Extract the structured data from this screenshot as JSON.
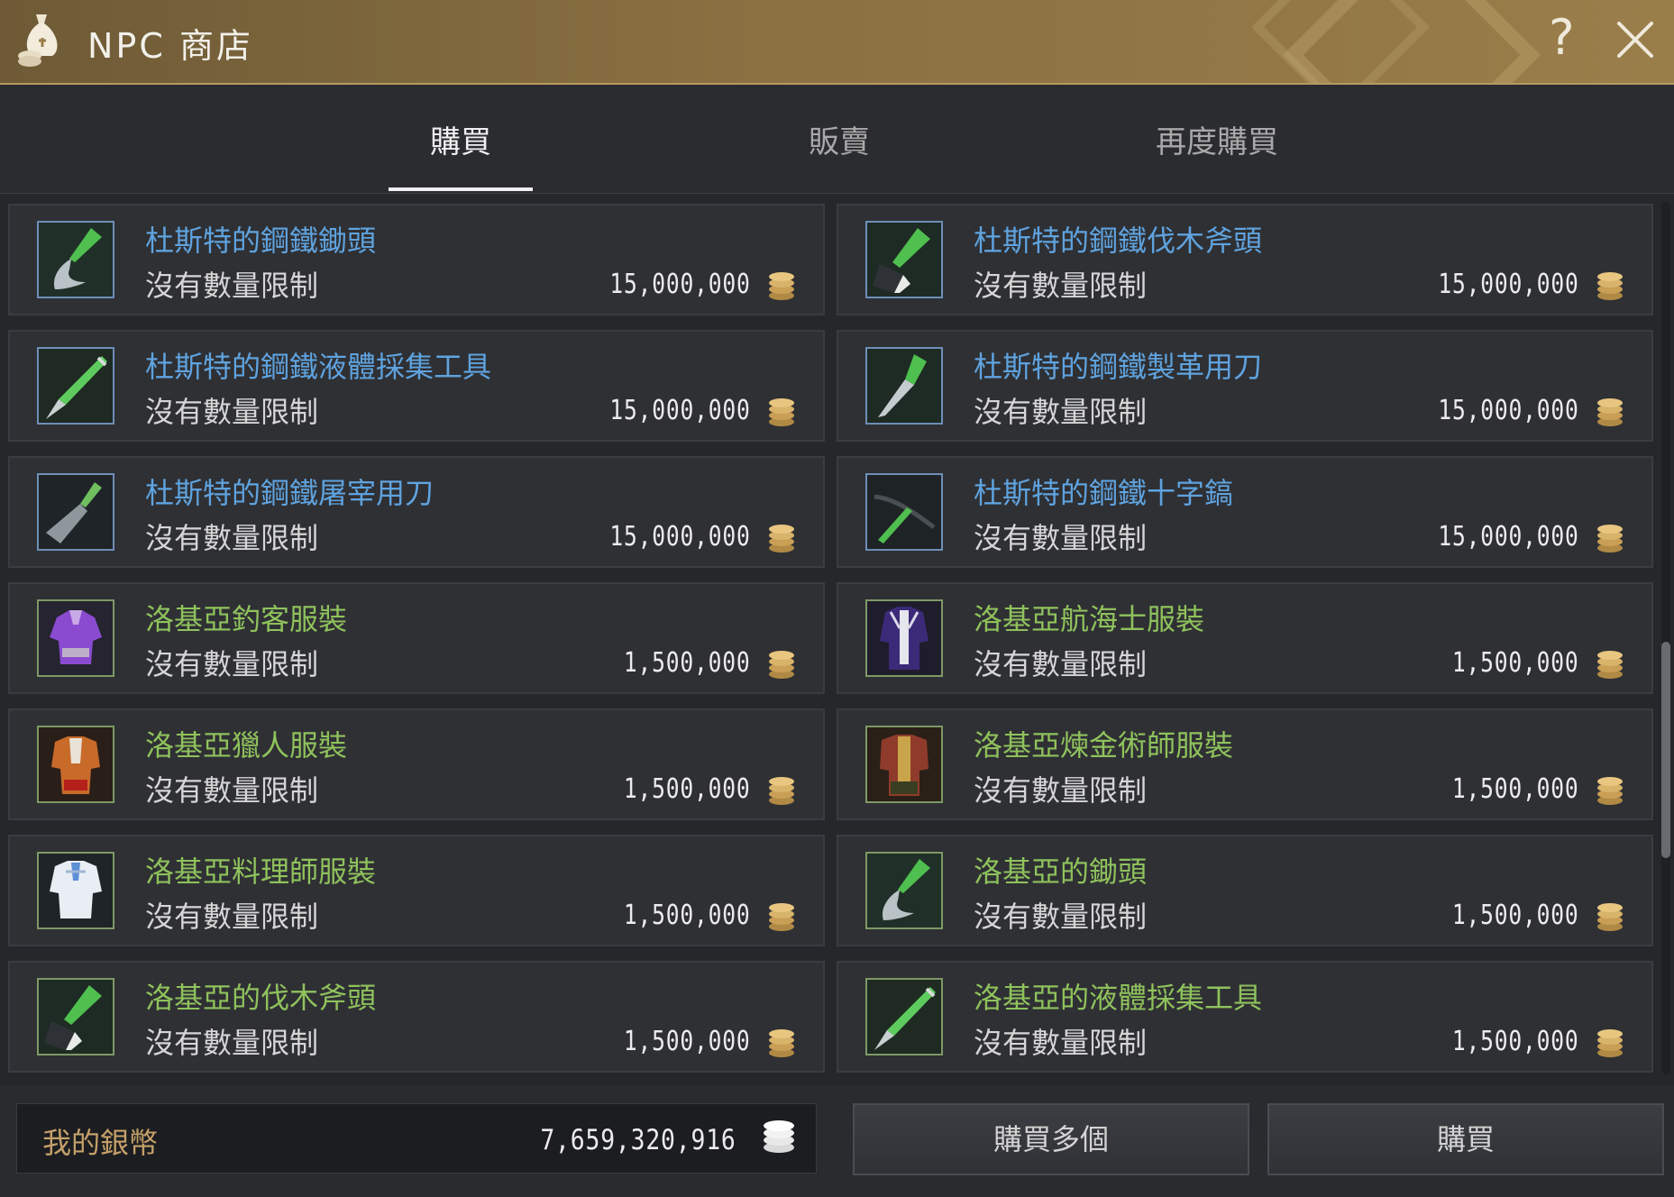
{
  "window": {
    "title": "NPC 商店",
    "icon": "money-bag-icon"
  },
  "tabs": [
    {
      "label": "購買",
      "active": true
    },
    {
      "label": "販賣",
      "active": false
    },
    {
      "label": "再度購買",
      "active": false
    }
  ],
  "items": [
    {
      "name": "杜斯特的鋼鐵鋤頭",
      "limit": "沒有數量限制",
      "price": "15,000,000",
      "grade": "blue",
      "icon": "hoe-icon"
    },
    {
      "name": "杜斯特的鋼鐵伐木斧頭",
      "limit": "沒有數量限制",
      "price": "15,000,000",
      "grade": "blue",
      "icon": "axe-icon"
    },
    {
      "name": "杜斯特的鋼鐵液體採集工具",
      "limit": "沒有數量限制",
      "price": "15,000,000",
      "grade": "blue",
      "icon": "syringe-icon"
    },
    {
      "name": "杜斯特的鋼鐵製革用刀",
      "limit": "沒有數量限制",
      "price": "15,000,000",
      "grade": "blue",
      "icon": "knife-icon"
    },
    {
      "name": "杜斯特的鋼鐵屠宰用刀",
      "limit": "沒有數量限制",
      "price": "15,000,000",
      "grade": "blue",
      "icon": "cleaver-icon"
    },
    {
      "name": "杜斯特的鋼鐵十字鎬",
      "limit": "沒有數量限制",
      "price": "15,000,000",
      "grade": "blue",
      "icon": "pickaxe-icon"
    },
    {
      "name": "洛基亞釣客服裝",
      "limit": "沒有數量限制",
      "price": "1,500,000",
      "grade": "green",
      "icon": "purple-outfit-icon"
    },
    {
      "name": "洛基亞航海士服裝",
      "limit": "沒有數量限制",
      "price": "1,500,000",
      "grade": "green",
      "icon": "sailor-outfit-icon"
    },
    {
      "name": "洛基亞獵人服裝",
      "limit": "沒有數量限制",
      "price": "1,500,000",
      "grade": "green",
      "icon": "hunter-outfit-icon"
    },
    {
      "name": "洛基亞煉金術師服裝",
      "limit": "沒有數量限制",
      "price": "1,500,000",
      "grade": "green",
      "icon": "alchemist-outfit-icon"
    },
    {
      "name": "洛基亞料理師服裝",
      "limit": "沒有數量限制",
      "price": "1,500,000",
      "grade": "green",
      "icon": "cook-outfit-icon"
    },
    {
      "name": "洛基亞的鋤頭",
      "limit": "沒有數量限制",
      "price": "1,500,000",
      "grade": "green",
      "icon": "hoe-icon"
    },
    {
      "name": "洛基亞的伐木斧頭",
      "limit": "沒有數量限制",
      "price": "1,500,000",
      "grade": "green",
      "icon": "axe-icon"
    },
    {
      "name": "洛基亞的液體採集工具",
      "limit": "沒有數量限制",
      "price": "1,500,000",
      "grade": "green",
      "icon": "syringe-icon"
    }
  ],
  "footer": {
    "silver_label": "我的銀幣",
    "silver_value": "7,659,320,916",
    "buy_multiple_label": "購買多個",
    "buy_label": "購買"
  },
  "colors": {
    "title_bar": "#8a7142",
    "blue_grade": "#5fa3df",
    "green_grade": "#8fc25c",
    "coin": "#d8b36a"
  }
}
